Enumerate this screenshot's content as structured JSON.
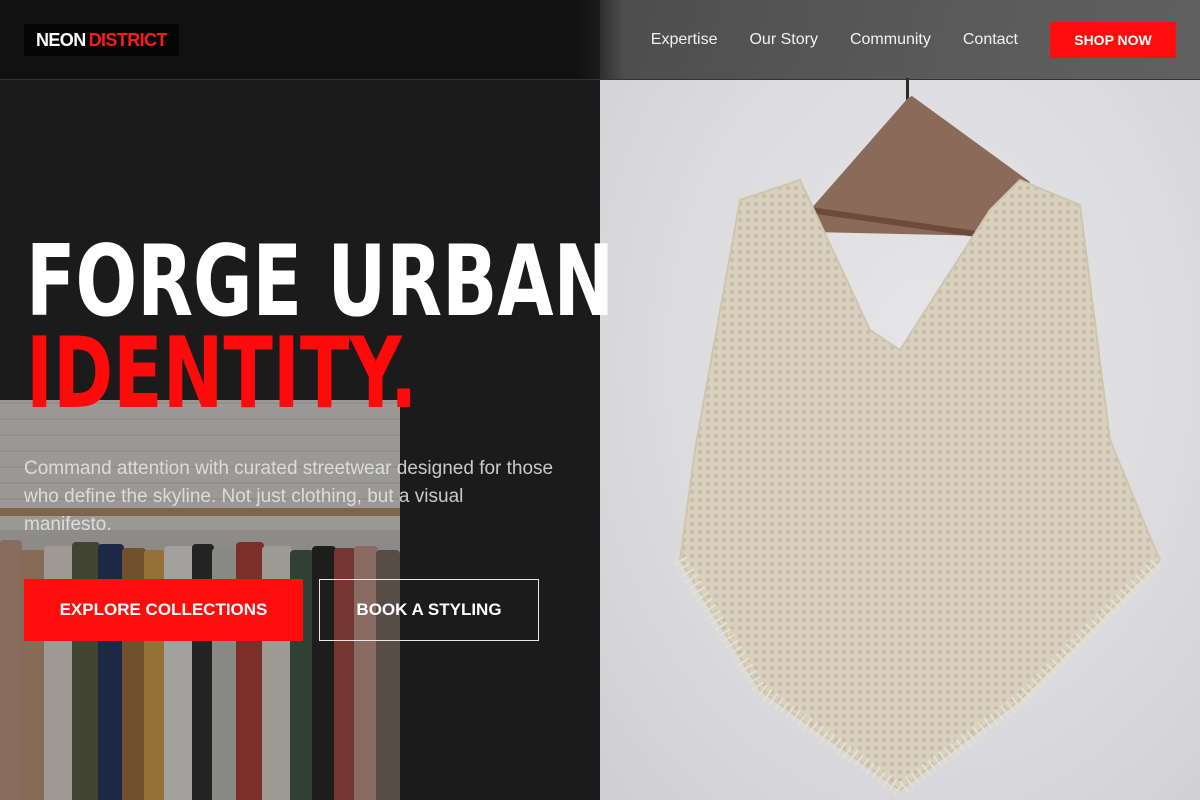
{
  "brand": {
    "name_part1": "NEON",
    "name_part2": "DISTRICT"
  },
  "nav": {
    "items": [
      "Expertise",
      "Our Story",
      "Community",
      "Contact"
    ],
    "cta_label": "SHOP NOW"
  },
  "hero": {
    "title_line1": "FORGE URBAN",
    "title_line2": "IDENTITY.",
    "subtitle": "Command attention with curated streetwear designed for those who define the skyline. Not just clothing, but a visual manifesto.",
    "primary_button": "EXPLORE COLLECTIONS",
    "secondary_button": "BOOK A STYLING"
  },
  "colors": {
    "accent": "#ff0d0d",
    "background": "#1b1b1b",
    "text": "#ffffff"
  }
}
